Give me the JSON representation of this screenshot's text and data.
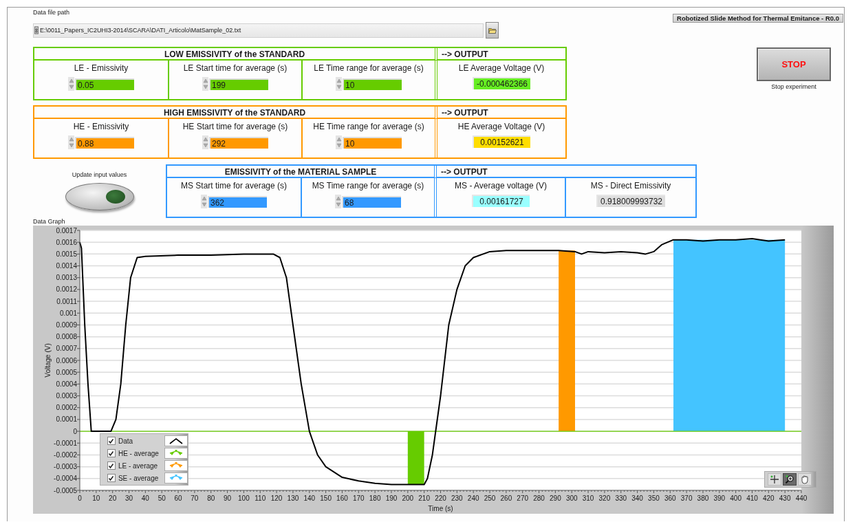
{
  "file_path": {
    "label": "Data file path",
    "value": "E:\\0011_Papers_IC2UHI3-2014\\SCARA\\DATI_Articolo\\MatSample_02.txt"
  },
  "app_title": "Robotized Slide Method for Thermal Emitance - R0.0",
  "stop_button": {
    "label": "STOP",
    "caption": "Stop experiment"
  },
  "groups": [
    {
      "title": "LOW EMISSIVITY of the STANDARD",
      "color": "#66cc00",
      "output_title": "--> OUTPUT",
      "inputs": [
        {
          "label": "LE - Emissivity",
          "value": "0.05"
        },
        {
          "label": "LE Start time for average (s)",
          "value": "199"
        },
        {
          "label": "LE Time range for average (s)",
          "value": "10"
        }
      ],
      "outputs": [
        {
          "label": "LE Average Voltage (V)",
          "value": "-0.000462366",
          "color": "#66ee22"
        }
      ]
    },
    {
      "title": "HIGH EMISSIVITY of the STANDARD",
      "color": "#ff9900",
      "output_title": "--> OUTPUT",
      "inputs": [
        {
          "label": "HE - Emissivity",
          "value": "0.88"
        },
        {
          "label": "HE Start time for average (s)",
          "value": "292"
        },
        {
          "label": "HE Time range for average (s)",
          "value": "10"
        }
      ],
      "outputs": [
        {
          "label": "HE Average Voltage (V)",
          "value": "0.00152621",
          "color": "#ffdd00"
        }
      ]
    },
    {
      "title": "EMISSIVITY of the MATERIAL SAMPLE",
      "color": "#3399ff",
      "output_title": "--> OUTPUT",
      "inputs": [
        {
          "label": "MS Start time for average (s)",
          "value": "362"
        },
        {
          "label": "MS Time range for average (s)",
          "value": "68"
        }
      ],
      "outputs": [
        {
          "label": "MS - Average voltage (V)",
          "value": "0.00161727",
          "color": "#99ffff"
        },
        {
          "label": "MS - Direct Emissivity",
          "value": "0.918009993732",
          "color": "#dddddd"
        }
      ]
    }
  ],
  "update_button": {
    "label": "Update input values"
  },
  "graph": {
    "label": "Data Graph",
    "legend": [
      {
        "checked": true
      },
      {
        "checked": true
      },
      {
        "checked": true
      },
      {
        "checked": true
      }
    ],
    "tools": [
      {
        "kind": "cursor",
        "selected": false
      },
      {
        "kind": "zoom",
        "selected": true
      },
      {
        "kind": "pan",
        "selected": false
      }
    ],
    "chart_data": {
      "type": "line",
      "grid": true,
      "ref_lines": [
        {
          "axis": "y",
          "value": 0,
          "color": "#66cc00"
        }
      ],
      "xlabel": "Time (s)",
      "ylabel": "Voltage (V)",
      "xlim": [
        0,
        440
      ],
      "ylim": [
        -0.0005,
        0.0017
      ],
      "xticks": [
        0,
        10,
        20,
        30,
        40,
        50,
        60,
        70,
        80,
        90,
        100,
        110,
        120,
        130,
        140,
        150,
        160,
        170,
        180,
        190,
        200,
        210,
        220,
        230,
        240,
        250,
        260,
        270,
        280,
        290,
        300,
        310,
        320,
        330,
        340,
        350,
        360,
        370,
        380,
        390,
        400,
        410,
        420,
        430,
        440
      ],
      "yticks": [
        0.0017,
        0.0016,
        0.0015,
        0.0014,
        0.0013,
        0.0012,
        0.0011,
        0.001,
        0.0009,
        0.0008,
        0.0007,
        0.0006,
        0.0005,
        0.0004,
        0.0003,
        0.0002,
        0.0001,
        0,
        -0.0001,
        -0.0002,
        -0.0003,
        -0.0004,
        -0.0005
      ],
      "x": [
        0,
        1,
        3,
        5,
        7,
        8,
        15,
        19,
        22,
        25,
        28,
        31,
        35,
        40,
        60,
        80,
        100,
        110,
        118,
        122,
        126,
        130,
        135,
        140,
        145,
        150,
        160,
        170,
        180,
        190,
        200,
        210,
        212,
        215,
        220,
        225,
        230,
        235,
        240,
        250,
        260,
        270,
        280,
        292,
        302,
        306,
        310,
        320,
        330,
        340,
        345,
        350,
        355,
        362,
        370,
        380,
        390,
        400,
        410,
        420,
        430
      ],
      "series": [
        {
          "name": "Data",
          "type": "line",
          "color": "#000000",
          "values": [
            0.0016,
            0.00155,
            0.0009,
            0.0004,
            0,
            0,
            0,
            0,
            0.0001,
            0.0004,
            0.0009,
            0.0013,
            0.00147,
            0.00148,
            0.00149,
            0.00149,
            0.0015,
            0.0015,
            0.0015,
            0.00147,
            0.0013,
            0.0009,
            0.0004,
            0,
            -0.0002,
            -0.0003,
            -0.00039,
            -0.00042,
            -0.00044,
            -0.00045,
            -0.00045,
            -0.00045,
            -0.0004,
            -0.0002,
            0.0003,
            0.0009,
            0.0012,
            0.0014,
            0.00147,
            0.00152,
            0.00153,
            0.00153,
            0.00153,
            0.00153,
            0.00152,
            0.0015,
            0.00152,
            0.00151,
            0.00152,
            0.00151,
            0.0015,
            0.00152,
            0.00158,
            0.00162,
            0.00162,
            0.00161,
            0.00162,
            0.00162,
            0.00163,
            0.00161,
            0.00162
          ]
        },
        {
          "name": "HE - average",
          "type": "area",
          "color": "#66cc00",
          "values": [
            null,
            null,
            null,
            null,
            null,
            null,
            null,
            null,
            null,
            null,
            null,
            null,
            null,
            null,
            null,
            null,
            null,
            null,
            null,
            null,
            null,
            null,
            null,
            null,
            null,
            null,
            null,
            null,
            null,
            null,
            -0.00045,
            -0.00045,
            null,
            null,
            null,
            null,
            null,
            null,
            null,
            null,
            null,
            null,
            null,
            null,
            null,
            null,
            null,
            null,
            null,
            null,
            null,
            null,
            null,
            null,
            null,
            null,
            null,
            null,
            null,
            null,
            null
          ]
        },
        {
          "name": "LE - average",
          "type": "area",
          "color": "#ff9900",
          "values": [
            null,
            null,
            null,
            null,
            null,
            null,
            null,
            null,
            null,
            null,
            null,
            null,
            null,
            null,
            null,
            null,
            null,
            null,
            null,
            null,
            null,
            null,
            null,
            null,
            null,
            null,
            null,
            null,
            null,
            null,
            null,
            null,
            null,
            null,
            null,
            null,
            null,
            null,
            null,
            null,
            null,
            null,
            null,
            0.00153,
            0.00153,
            null,
            null,
            null,
            null,
            null,
            null,
            null,
            null,
            null,
            null,
            null,
            null,
            null,
            null,
            null,
            null
          ]
        },
        {
          "name": "SE - average",
          "type": "area",
          "color": "#44c4ff",
          "values": [
            null,
            null,
            null,
            null,
            null,
            null,
            null,
            null,
            null,
            null,
            null,
            null,
            null,
            null,
            null,
            null,
            null,
            null,
            null,
            null,
            null,
            null,
            null,
            null,
            null,
            null,
            null,
            null,
            null,
            null,
            null,
            null,
            null,
            null,
            null,
            null,
            null,
            null,
            null,
            null,
            null,
            null,
            null,
            null,
            null,
            null,
            null,
            null,
            null,
            null,
            null,
            null,
            null,
            0.00162,
            0.00162,
            0.00162,
            0.00162,
            0.00162,
            0.00162,
            0.00162,
            0.00162
          ]
        }
      ]
    }
  }
}
